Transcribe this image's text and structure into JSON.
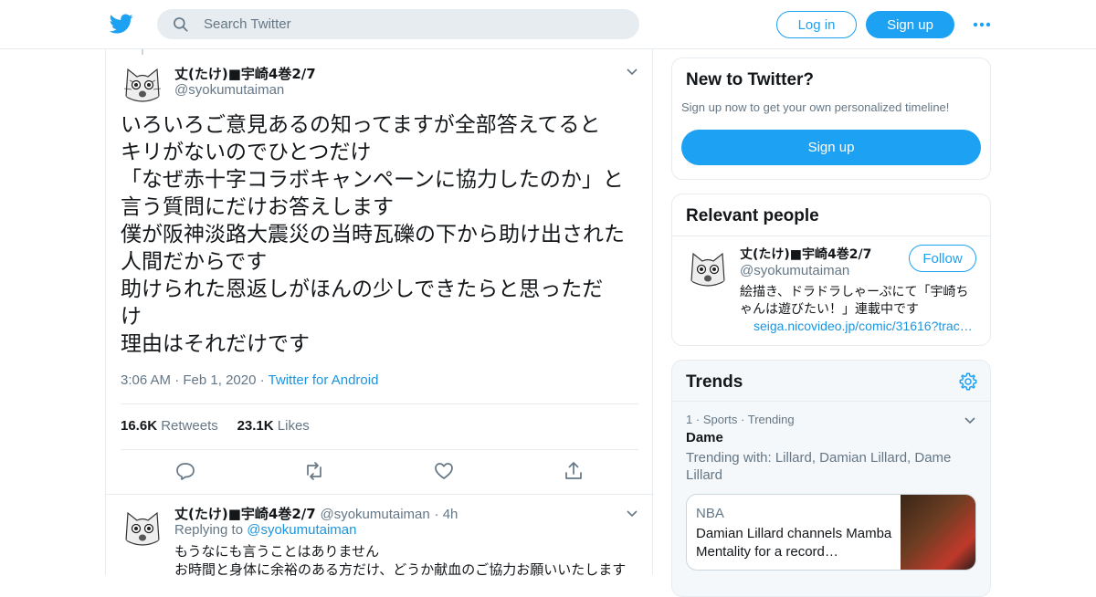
{
  "header": {
    "search_placeholder": "Search Twitter",
    "login_label": "Log in",
    "signup_label": "Sign up"
  },
  "tweet": {
    "name": "丈(たけ)■宇崎4巻2/7",
    "handle": "@syokumutaiman",
    "text": "いろいろご意見あるの知ってますが全部答えてると\nキリがないのでひとつだけ\n「なぜ赤十字コラボキャンペーンに協力したのか」と\n言う質問にだけお答えします\n僕が阪神淡路大震災の当時瓦礫の下から助け出された\n人間だからです\n助けられた恩返しがほんの少しできたらと思っただ\nけ\n理由はそれだけです",
    "time": "3:06 AM",
    "date": "Feb 1, 2020",
    "source": "Twitter for Android",
    "retweets": "16.6K",
    "retweets_label": "Retweets",
    "likes": "23.1K",
    "likes_label": "Likes"
  },
  "reply": {
    "name": "丈(たけ)■宇崎4巻2/7",
    "handle": "@syokumutaiman",
    "age": "4h",
    "replying_label": "Replying to",
    "replying_to": "@syokumutaiman",
    "text": "もうなにも言うことはありません\nお時間と身体に余裕のある方だけ、どうか献血のご協力お願いいたします"
  },
  "sidebar": {
    "new_title": "New to Twitter?",
    "new_sub": "Sign up now to get your own personalized timeline!",
    "new_button": "Sign up",
    "relevant_title": "Relevant people",
    "person_name": "丈(たけ)■宇崎4巻2/7",
    "person_handle": "@syokumutaiman",
    "follow_label": "Follow",
    "person_bio": "絵描き、ドラドラしゃーぷにて「宇崎ちゃんは遊びたい！」連載中です",
    "person_link": "seiga.nicovideo.jp/comic/31616?track=…",
    "trends_title": "Trends",
    "trend_rank": "1",
    "trend_category": "Sports",
    "trend_status": "Trending",
    "trend_name": "Dame",
    "trend_with": "Trending with: Lillard, Damian Lillard, Dame Lillard",
    "news_source": "NBA",
    "news_text": "Damian Lillard channels Mamba Mentality for a record…"
  },
  "colors": {
    "accent": "#1da1f2",
    "link": "#1b95e0",
    "muted": "#657786"
  }
}
